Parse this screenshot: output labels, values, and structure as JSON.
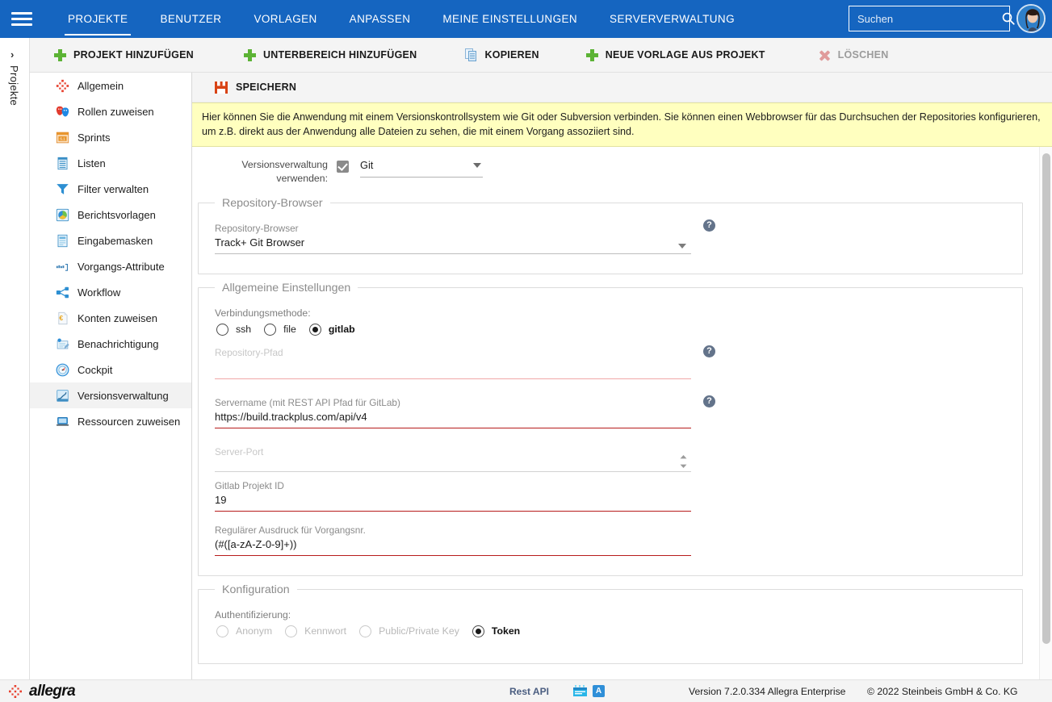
{
  "theme": {
    "nav_bg": "#1565c0",
    "accent_green": "#5cb335",
    "notice_bg": "#ffffbf",
    "error_line": "#b71c1c"
  },
  "topnav": {
    "menu_icon": "hamburger-icon",
    "tabs": [
      {
        "label": "PROJEKTE",
        "active": true
      },
      {
        "label": "BENUTZER",
        "active": false
      },
      {
        "label": "VORLAGEN",
        "active": false
      },
      {
        "label": "ANPASSEN",
        "active": false
      },
      {
        "label": "MEINE EINSTELLUNGEN",
        "active": false
      },
      {
        "label": "SERVERVERWALTUNG",
        "active": false
      }
    ],
    "search": {
      "placeholder": "Suchen",
      "value": "",
      "icon": "search-icon"
    },
    "avatar": "user-avatar"
  },
  "leftrail": {
    "chevron": "›",
    "label": "Projekte"
  },
  "toolbar": {
    "buttons": [
      {
        "label": "PROJEKT HINZUFÜGEN",
        "icon": "plus-icon",
        "disabled": false
      },
      {
        "label": "UNTERBEREICH HINZUFÜGEN",
        "icon": "plus-icon",
        "disabled": false
      },
      {
        "label": "KOPIEREN",
        "icon": "copy-icon",
        "disabled": false
      },
      {
        "label": "NEUE VORLAGE AUS PROJEKT",
        "icon": "plus-icon",
        "disabled": false
      },
      {
        "label": "LÖSCHEN",
        "icon": "delete-x-icon",
        "disabled": true
      }
    ]
  },
  "savebar": {
    "label": "SPEICHERN",
    "icon": "save-icon"
  },
  "notice": {
    "text": "Hier können Sie die Anwendung mit einem Versionskontrollsystem wie Git oder Subversion verbinden. Sie können einen Webbrowser für das Durchsuchen der Repositories konfigurieren, um z.B. direkt aus der Anwendung alle Dateien zu sehen, die mit einem Vorgang assoziiert sind."
  },
  "sidebar": {
    "items": [
      {
        "label": "Allgemein",
        "icon": "general-icon",
        "active": false
      },
      {
        "label": "Rollen zuweisen",
        "icon": "roles-masks-icon",
        "active": false
      },
      {
        "label": "Sprints",
        "icon": "sprints-icon",
        "active": false
      },
      {
        "label": "Listen",
        "icon": "lists-icon",
        "active": false
      },
      {
        "label": "Filter verwalten",
        "icon": "filter-icon",
        "active": false
      },
      {
        "label": "Berichtsvorlagen",
        "icon": "report-templates-icon",
        "active": false
      },
      {
        "label": "Eingabemasken",
        "icon": "input-forms-icon",
        "active": false
      },
      {
        "label": "Vorgangs-Attribute",
        "icon": "issue-attributes-icon",
        "active": false
      },
      {
        "label": "Workflow",
        "icon": "workflow-icon",
        "active": false
      },
      {
        "label": "Konten zuweisen",
        "icon": "accounts-euro-icon",
        "active": false
      },
      {
        "label": "Benachrichtigung",
        "icon": "notification-icon",
        "active": false
      },
      {
        "label": "Cockpit",
        "icon": "cockpit-gauge-icon",
        "active": false
      },
      {
        "label": "Versionsverwaltung",
        "icon": "version-control-icon",
        "active": true
      },
      {
        "label": "Ressourcen zuweisen",
        "icon": "resources-laptop-icon",
        "active": false
      }
    ]
  },
  "form": {
    "use_vcs": {
      "label": "Versionsverwaltung verwenden:",
      "checked": true,
      "select_value": "Git"
    },
    "repository_browser_group": {
      "legend": "Repository-Browser",
      "field": {
        "label": "Repository-Browser",
        "value": "Track+ Git Browser",
        "help": "?"
      }
    },
    "general_settings_group": {
      "legend": "Allgemeine Einstellungen",
      "connection_method": {
        "label": "Verbindungsmethode:",
        "options": [
          {
            "label": "ssh",
            "selected": false
          },
          {
            "label": "file",
            "selected": false
          },
          {
            "label": "gitlab",
            "selected": true
          }
        ]
      },
      "fields": [
        {
          "label": "Repository-Pfad",
          "value": "",
          "muted": true,
          "help": "?",
          "line": "pink"
        },
        {
          "label": "Servername (mit REST API Pfad für GitLab)",
          "value": "https://build.trackplus.com/api/v4",
          "muted": false,
          "help": "?",
          "line": "red"
        },
        {
          "label": "Server-Port",
          "value": "",
          "muted": true,
          "help": "",
          "line": "grey"
        },
        {
          "label": "Gitlab Projekt ID",
          "value": "19",
          "muted": false,
          "help": "",
          "line": "red"
        },
        {
          "label": "Regulärer Ausdruck für Vorgangsnr.",
          "value": "(#([a-zA-Z-0-9]+))",
          "muted": false,
          "help": "",
          "line": "red"
        }
      ]
    },
    "configuration_group": {
      "legend": "Konfiguration",
      "authentication": {
        "label": "Authentifizierung:",
        "options": [
          {
            "label": "Anonym",
            "selected": false,
            "dim": true
          },
          {
            "label": "Kennwort",
            "selected": false,
            "dim": true
          },
          {
            "label": "Public/Private Key",
            "selected": false,
            "dim": true
          },
          {
            "label": "Token",
            "selected": true,
            "dim": false
          }
        ]
      }
    }
  },
  "footer": {
    "brand": "allegra",
    "rest_api": "Rest API",
    "icon1": "changelog-icon",
    "icon2": "about-a-icon",
    "version": "Version 7.2.0.334 Allegra Enterprise",
    "copyright": "© 2022 Steinbeis GmbH & Co. KG"
  }
}
